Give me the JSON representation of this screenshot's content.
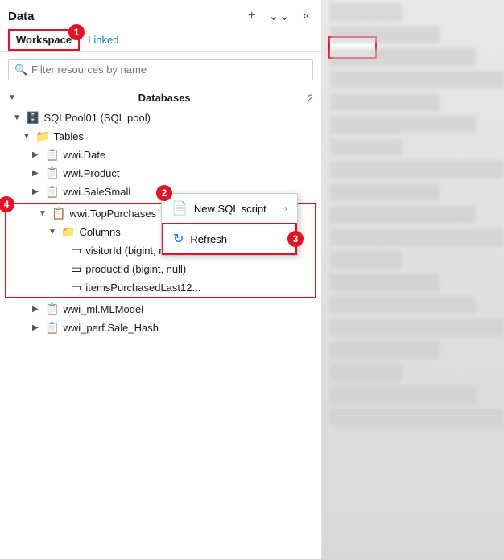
{
  "header": {
    "title": "Data",
    "add_icon": "+",
    "sort_icon": "⌄⌄",
    "collapse_icon": "«"
  },
  "tabs": {
    "workspace": "Workspace",
    "linked": "Linked"
  },
  "search": {
    "placeholder": "Filter resources by name"
  },
  "tree": {
    "databases_label": "Databases",
    "databases_count": "2",
    "sqlpool_label": "SQLPool01 (SQL pool)",
    "tables_label": "Tables",
    "items": [
      {
        "label": "wwi.Date"
      },
      {
        "label": "wwi.Product"
      },
      {
        "label": "wwi.SaleSmall"
      },
      {
        "label": "wwi.TopPurchases"
      },
      {
        "label": "wwi_ml.MLModel"
      },
      {
        "label": "wwi_perf.Sale_Hash"
      }
    ],
    "columns_label": "Columns",
    "columns": [
      {
        "label": "visitorId (bigint, null)"
      },
      {
        "label": "productId (bigint, null)"
      },
      {
        "label": "itemsPurchasedLast12..."
      }
    ]
  },
  "context_menu": {
    "new_sql_script": "New SQL script",
    "refresh": "Refresh"
  },
  "badges": {
    "1": "1",
    "2": "2",
    "3": "3",
    "4": "4"
  }
}
